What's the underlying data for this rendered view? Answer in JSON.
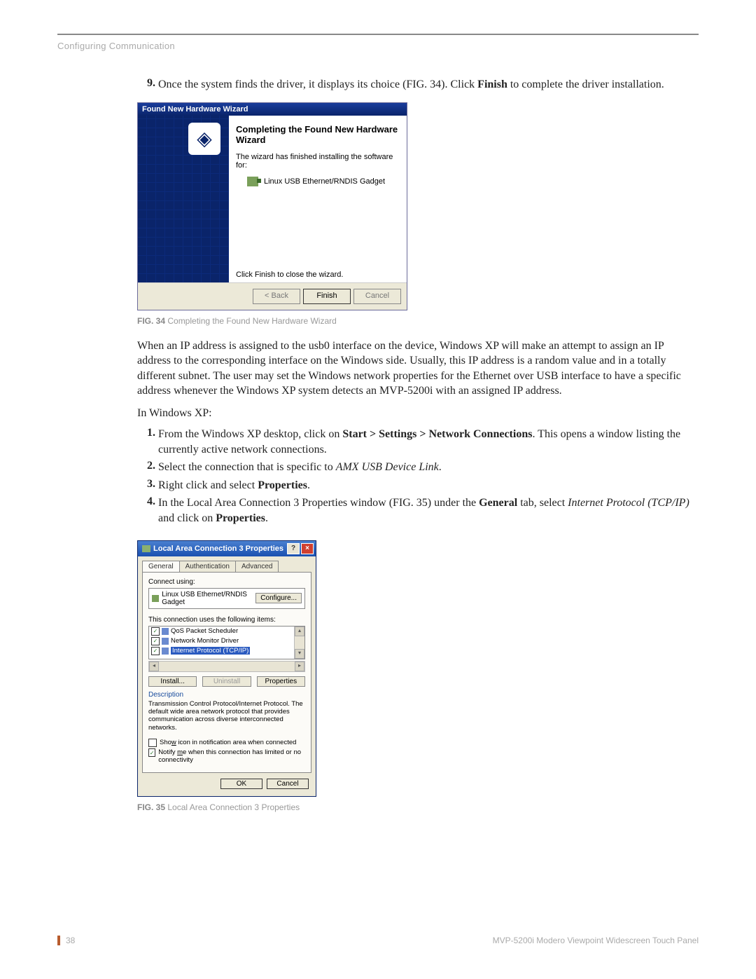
{
  "header": {
    "section": "Configuring Communication"
  },
  "step9": {
    "num": "9.",
    "pre": "Once the system finds the driver, it displays its choice (FIG. 34). Click ",
    "bold": "Finish",
    "post": " to complete the driver installation."
  },
  "fig34": {
    "window_title": "Found New Hardware Wizard",
    "heading": "Completing the Found New Hardware Wizard",
    "sub": "The wizard has finished installing the software for:",
    "device": "Linux USB Ethernet/RNDIS Gadget",
    "close_text": "Click Finish to close the wizard.",
    "btn_back": "< Back",
    "btn_finish": "Finish",
    "btn_cancel": "Cancel",
    "caption_label": "FIG. 34",
    "caption_text": "  Completing the Found New Hardware Wizard"
  },
  "para1": "When an IP address is assigned to the usb0 interface on the device, Windows XP will make an attempt to assign an IP address to the corresponding interface on the Windows side. Usually, this IP address is a random value and in a totally different subnet. The user may set the Windows network properties for the Ethernet over USB interface to have a specific address whenever the Windows XP system detects an MVP-5200i with an assigned IP address.",
  "para2": "In Windows XP:",
  "steps2": [
    {
      "num": "1.",
      "parts": [
        {
          "t": "From the Windows XP desktop, click on "
        },
        {
          "t": "Start > Settings > Network Connections",
          "b": true
        },
        {
          "t": ". This opens a window listing the currently active network connections."
        }
      ]
    },
    {
      "num": "2.",
      "parts": [
        {
          "t": "Select the connection that is specific to "
        },
        {
          "t": "AMX USB Device Link",
          "i": true
        },
        {
          "t": "."
        }
      ]
    },
    {
      "num": "3.",
      "parts": [
        {
          "t": "Right click and select "
        },
        {
          "t": "Properties",
          "b": true
        },
        {
          "t": "."
        }
      ]
    },
    {
      "num": "4.",
      "parts": [
        {
          "t": "In the Local Area Connection 3 Properties window (FIG. 35) under the "
        },
        {
          "t": "General",
          "b": true
        },
        {
          "t": " tab, select "
        },
        {
          "t": "Internet Protocol (TCP/IP)",
          "i": true
        },
        {
          "t": " and click on "
        },
        {
          "t": "Properties",
          "b": true
        },
        {
          "t": "."
        }
      ]
    }
  ],
  "fig35": {
    "title": "Local Area Connection 3 Properties",
    "help": "?",
    "close": "×",
    "tabs": {
      "general": "General",
      "auth": "Authentication",
      "adv": "Advanced"
    },
    "connect_using": "Connect using:",
    "nic": "Linux USB Ethernet/RNDIS Gadget",
    "configure": "Configure...",
    "uses_label": "This connection uses the following items:",
    "items": [
      {
        "label": "QoS Packet Scheduler",
        "checked": true,
        "hl": false
      },
      {
        "label": "Network Monitor Driver",
        "checked": true,
        "hl": false
      },
      {
        "label": "Internet Protocol (TCP/IP)",
        "checked": true,
        "hl": true
      }
    ],
    "install": "Install...",
    "uninstall": "Uninstall",
    "properties": "Properties",
    "desc_label": "Description",
    "desc_text": "Transmission Control Protocol/Internet Protocol. The default wide area network protocol that provides communication across diverse interconnected networks.",
    "chk1_pre": "Sho",
    "chk1_u": "w",
    "chk1_post": " icon in notification area when connected",
    "chk1_checked": false,
    "chk2_pre": "Notify ",
    "chk2_u": "m",
    "chk2_post": "e when this connection has limited or no connectivity",
    "chk2_checked": true,
    "ok": "OK",
    "cancel": "Cancel",
    "caption_label": "FIG. 35",
    "caption_text": "  Local Area Connection 3 Properties"
  },
  "footer": {
    "page": "38",
    "title": "MVP-5200i Modero Viewpoint Widescreen Touch Panel"
  }
}
